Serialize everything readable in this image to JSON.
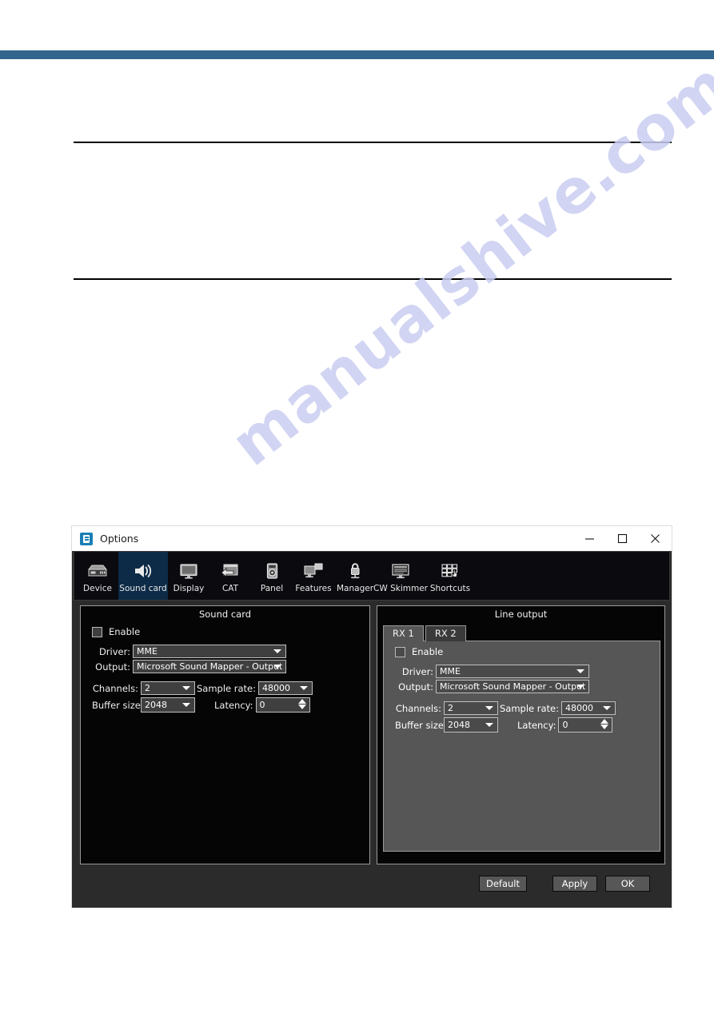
{
  "page": {
    "watermark": "manualshive.com"
  },
  "dialog": {
    "title": "Options",
    "window_controls": {
      "minimize": "minimize-icon",
      "maximize": "maximize-icon",
      "close": "close-icon"
    }
  },
  "toolbar": {
    "items": [
      {
        "label": "Device",
        "icon": "hard-drive-icon",
        "active": false
      },
      {
        "label": "Sound card",
        "icon": "speaker-icon",
        "active": true
      },
      {
        "label": "Display",
        "icon": "monitor-icon",
        "active": false
      },
      {
        "label": "CAT",
        "icon": "cat-window-icon",
        "active": false
      },
      {
        "label": "Panel",
        "icon": "panel-device-icon",
        "active": false
      },
      {
        "label": "Features",
        "icon": "two-screens-icon",
        "active": false
      },
      {
        "label": "Manager",
        "icon": "lock-icon",
        "active": false
      },
      {
        "label": "CW Skimmer",
        "icon": "skimmer-icon",
        "active": false
      },
      {
        "label": "Shortcuts",
        "icon": "keypad-hand-icon",
        "active": false
      }
    ]
  },
  "sound_card": {
    "title": "Sound card",
    "enable_label": "Enable",
    "enable_checked": false,
    "driver_label": "Driver:",
    "driver_value": "MME",
    "output_label": "Output:",
    "output_value": "Microsoft Sound Mapper - Output",
    "channels_label": "Channels:",
    "channels_value": "2",
    "sample_rate_label": "Sample rate:",
    "sample_rate_value": "48000",
    "buffer_size_label": "Buffer size:",
    "buffer_size_value": "2048",
    "latency_label": "Latency:",
    "latency_value": "0"
  },
  "line_output": {
    "title": "Line output",
    "tabs": [
      {
        "label": "RX 1",
        "active": true
      },
      {
        "label": "RX 2",
        "active": false
      }
    ],
    "enable_label": "Enable",
    "enable_checked": false,
    "driver_label": "Driver:",
    "driver_value": "MME",
    "output_label": "Output:",
    "output_value": "Microsoft Sound Mapper - Output",
    "channels_label": "Channels:",
    "channels_value": "2",
    "sample_rate_label": "Sample rate:",
    "sample_rate_value": "48000",
    "buffer_size_label": "Buffer size:",
    "buffer_size_value": "2048",
    "latency_label": "Latency:",
    "latency_value": "0"
  },
  "footer": {
    "default_label": "Default",
    "apply_label": "Apply",
    "ok_label": "OK"
  }
}
